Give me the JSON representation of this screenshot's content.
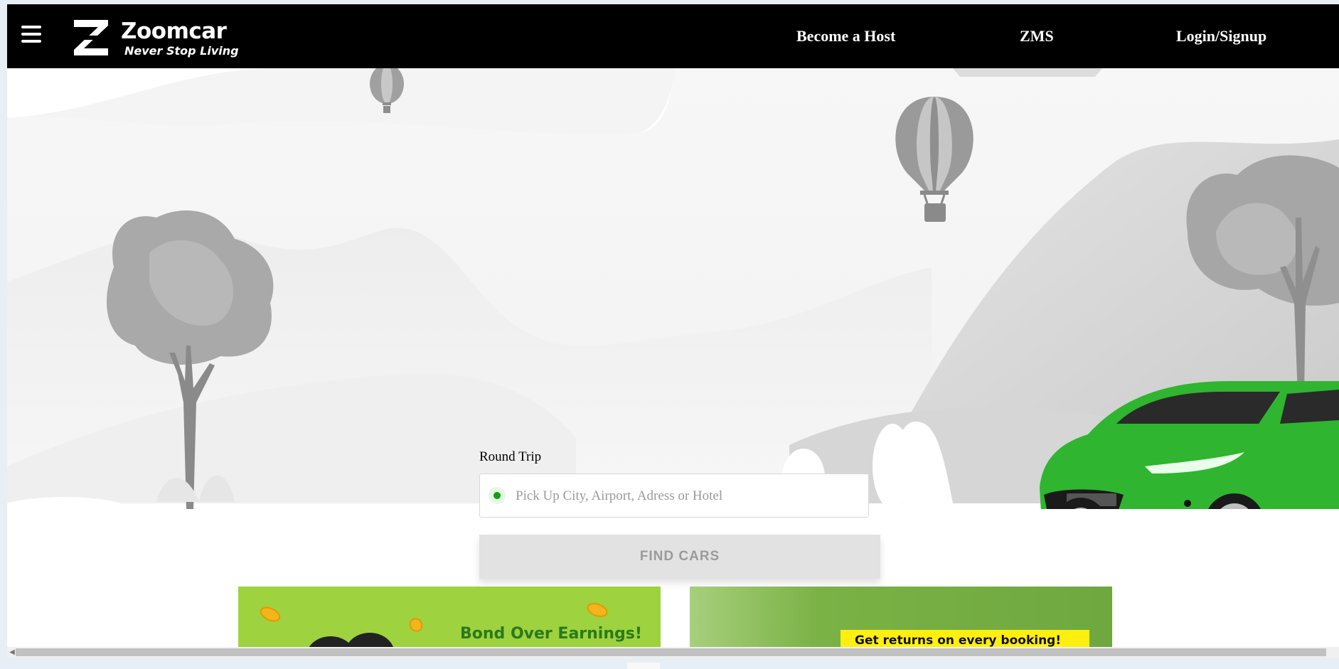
{
  "header": {
    "brand_name": "Zoomcar",
    "brand_tagline": "Never Stop Living",
    "nav": [
      {
        "label": "Become a Host"
      },
      {
        "label": "ZMS"
      },
      {
        "label": "Login/Signup"
      }
    ]
  },
  "search": {
    "trip_type_label": "Round Trip",
    "pickup_placeholder": "Pick Up City, Airport, Adress or Hotel",
    "pickup_value": "",
    "find_button_label": "FIND CARS"
  },
  "promos": [
    {
      "headline": "Bond Over Earnings!"
    },
    {
      "headline": "Get returns on every booking!"
    }
  ],
  "colors": {
    "header_bg": "#000000",
    "accent_green": "#2fb52f",
    "pickup_dot": "#10a010",
    "find_button_bg": "#e2e2e2",
    "promo_yellow": "#ffef10"
  },
  "icons": {
    "menu": "hamburger-icon",
    "logo": "zoomcar-logo",
    "pickup": "location-dot-icon",
    "scroll_left": "chevron-left-icon"
  }
}
